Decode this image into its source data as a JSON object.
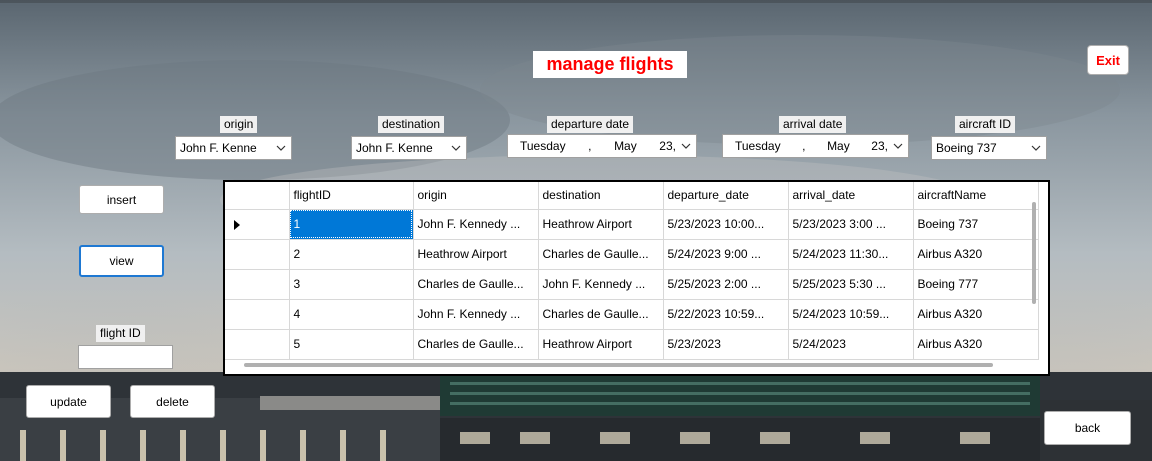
{
  "title": "manage flights",
  "exit_label": "Exit",
  "fields": {
    "origin": {
      "label": "origin",
      "value": "John F. Kenne"
    },
    "destination": {
      "label": "destination",
      "value": "John F. Kenne"
    },
    "departure": {
      "label": "departure date",
      "day": "Tuesday",
      "sep": ",",
      "month": "May",
      "date": "23,"
    },
    "arrival": {
      "label": "arrival date",
      "day": "Tuesday",
      "sep": ",",
      "month": "May",
      "date": "23,"
    },
    "aircraft": {
      "label": "aircraft ID",
      "value": "Boeing 737"
    }
  },
  "buttons": {
    "insert": "insert",
    "view": "view",
    "update": "update",
    "delete": "delete",
    "back": "back"
  },
  "flight_id_label": "flight ID",
  "flight_id_value": "",
  "table": {
    "columns": [
      "flightID",
      "origin",
      "destination",
      "departure_date",
      "arrival_date",
      "aircraftName"
    ],
    "rows": [
      [
        "1",
        "John F. Kennedy ...",
        "Heathrow Airport",
        "5/23/2023 10:00...",
        "5/23/2023 3:00 ...",
        "Boeing 737"
      ],
      [
        "2",
        "Heathrow Airport",
        "Charles de Gaulle...",
        "5/24/2023 9:00 ...",
        "5/24/2023 11:30...",
        "Airbus A320"
      ],
      [
        "3",
        "Charles de Gaulle...",
        "John F. Kennedy ...",
        "5/25/2023 2:00 ...",
        "5/25/2023 5:30 ...",
        "Boeing 777"
      ],
      [
        "4",
        "John F. Kennedy ...",
        "Charles de Gaulle...",
        "5/22/2023 10:59...",
        "5/24/2023 10:59...",
        "Airbus A320"
      ],
      [
        "5",
        "Charles de Gaulle...",
        "Heathrow Airport",
        "5/23/2023",
        "5/24/2023",
        "Airbus A320"
      ]
    ],
    "selected_row": 0
  }
}
